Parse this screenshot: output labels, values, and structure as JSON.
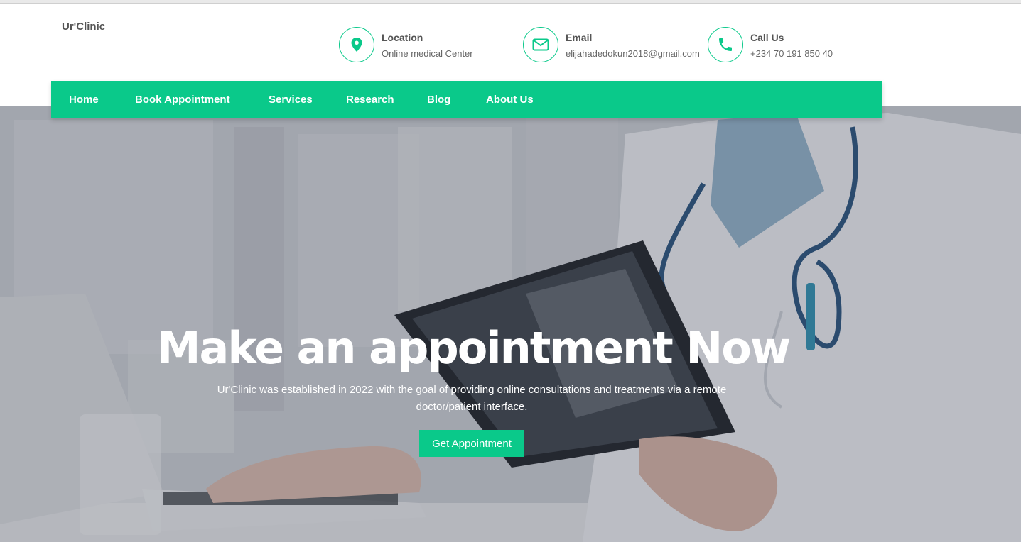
{
  "brand": {
    "name": "Ur'Clinic"
  },
  "contacts": [
    {
      "icon": "map-pin-icon",
      "title": "Location",
      "value": "Online medical Center"
    },
    {
      "icon": "envelope-icon",
      "title": "Email",
      "value": "elijahadedokun2018@gmail.com"
    },
    {
      "icon": "phone-icon",
      "title": "Call Us",
      "value": "+234 70 191 850 40"
    }
  ],
  "nav": {
    "items": [
      {
        "label": "Home"
      },
      {
        "label": "Book Appointment"
      },
      {
        "label": "Services"
      },
      {
        "label": "Research"
      },
      {
        "label": "Blog"
      },
      {
        "label": "About Us"
      }
    ]
  },
  "hero": {
    "title": "Make an appointment Now",
    "description": "Ur'Clinic was established in 2022 with the goal of providing online consultations and treatments via a remote doctor/patient interface.",
    "button_label": "Get Appointment"
  },
  "colors": {
    "accent": "#0ac98a",
    "text_dark": "#555555",
    "text_muted": "#666666",
    "white": "#ffffff"
  }
}
